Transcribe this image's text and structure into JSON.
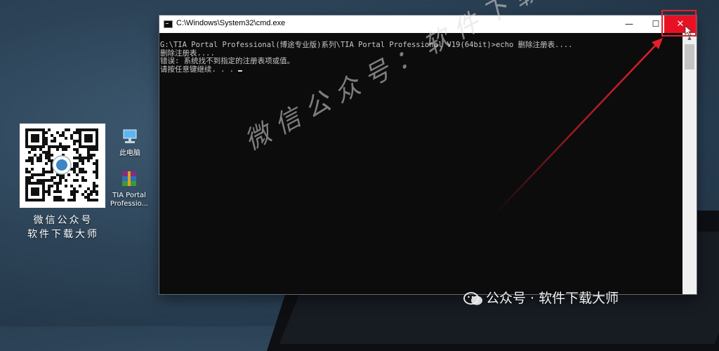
{
  "desktop": {
    "qr_caption_line1": "微信公众号",
    "qr_caption_line2": "软件下载大师",
    "icons": [
      {
        "label": "此电脑",
        "icon": "computer-icon"
      },
      {
        "label": "TIA Portal Professio...",
        "icon": "winrar-archive-icon"
      }
    ]
  },
  "window": {
    "title": "C:\\Windows\\System32\\cmd.exe",
    "minimize_glyph": "—",
    "maximize_glyph": "☐",
    "close_glyph": "✕"
  },
  "console": {
    "lines": [
      "G:\\TIA Portal Professional(博途专业版)系列\\TIA Portal Professional V19(64bit)>echo 删除注册表....",
      "删除注册表....",
      "错误: 系统找不到指定的注册表项或值。",
      "请按任意键继续. . . "
    ]
  },
  "watermarks": {
    "diagonal": "微信公众号：软件下载大师",
    "bottom": "公众号 · 软件下载大师"
  },
  "colors": {
    "close_button": "#e81123",
    "annotation_red": "#e3202a",
    "console_bg": "#0c0c0c"
  }
}
